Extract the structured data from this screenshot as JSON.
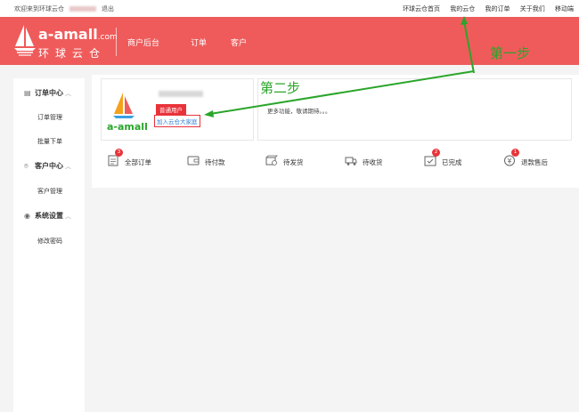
{
  "topbar": {
    "welcome": "欢迎来到环球云仓",
    "logout": "退出",
    "links": [
      "环球云仓首页",
      "我的云仓",
      "我的订单",
      "关于我们",
      "移动端"
    ]
  },
  "header": {
    "brand_main": "a-amall",
    "brand_suffix": ".com",
    "brand_cn": "环球云仓",
    "nav": [
      "商户后台",
      "订单",
      "客户"
    ]
  },
  "sidebar": {
    "sections": [
      {
        "title": "订单中心",
        "items": [
          "订单管理",
          "批量下单"
        ]
      },
      {
        "title": "客户中心",
        "items": [
          "客户管理"
        ]
      },
      {
        "title": "系统设置",
        "items": [
          "修改密码"
        ]
      }
    ]
  },
  "user": {
    "logo_text": "a-amall",
    "badge": "普通用户",
    "join": "加入云仓大家庭"
  },
  "info": {
    "text": "更多功能，敬请期待。。。"
  },
  "orders": [
    {
      "label": "全部订单",
      "count": "3"
    },
    {
      "label": "待付款",
      "count": ""
    },
    {
      "label": "待发货",
      "count": ""
    },
    {
      "label": "待收货",
      "count": ""
    },
    {
      "label": "已完成",
      "count": "2"
    },
    {
      "label": "退款售后",
      "count": "1"
    }
  ],
  "annotations": {
    "step1": "第一步",
    "step2": "第二步"
  },
  "colors": {
    "header": "#ef5b5b",
    "badge": "#e8333a",
    "annotation": "#2aa52a",
    "link": "#2f7fd6"
  }
}
